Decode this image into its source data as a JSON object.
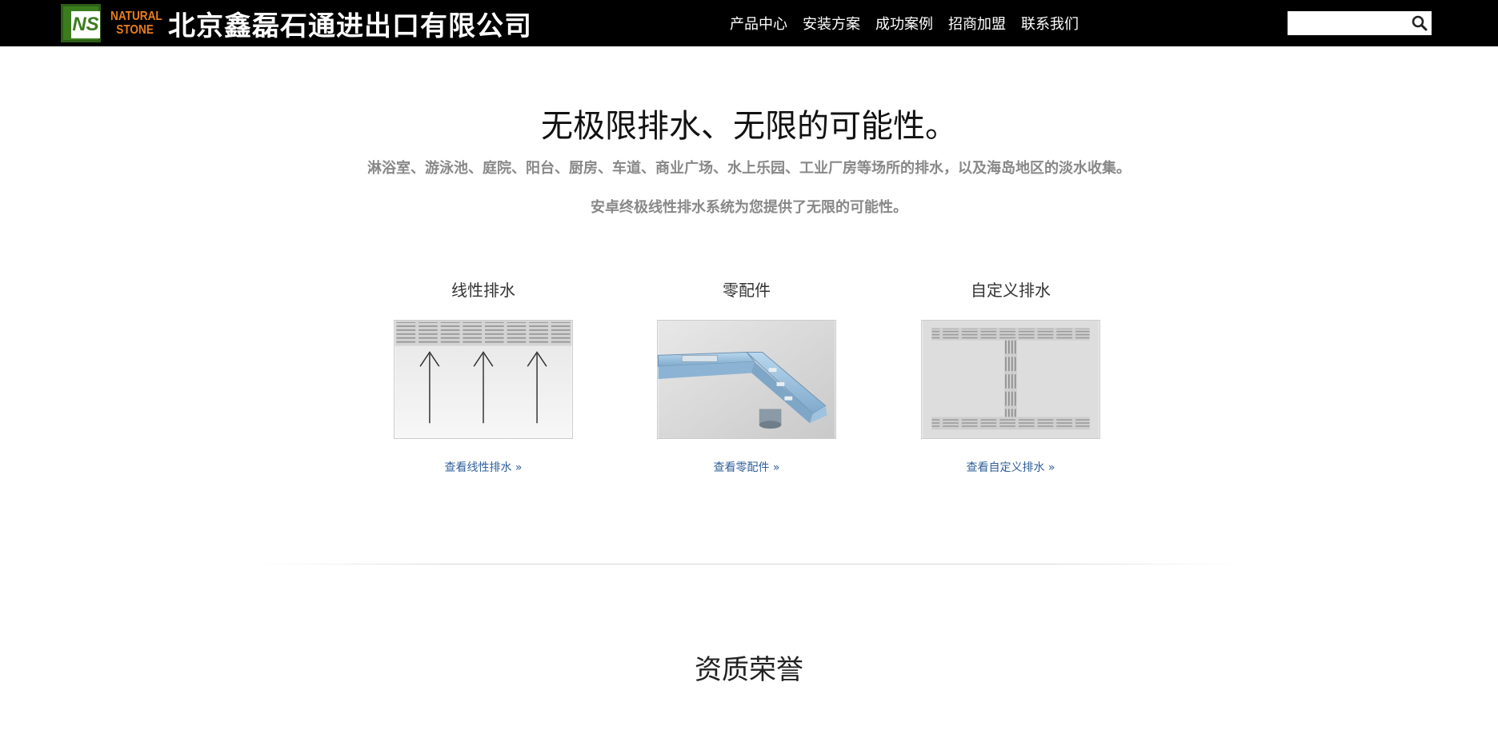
{
  "header": {
    "logo_mark": "NS",
    "logo_en_line1": "NATURAL",
    "logo_en_line2": "STONE",
    "company_name": "北京鑫磊石通进出口有限公司",
    "nav": [
      {
        "label": "产品中心"
      },
      {
        "label": "安装方案"
      },
      {
        "label": "成功案例"
      },
      {
        "label": "招商加盟"
      },
      {
        "label": "联系我们"
      }
    ],
    "search": {
      "value": "",
      "placeholder": "",
      "icon": "search-icon"
    }
  },
  "hero": {
    "title": "无极限排水、无限的可能性。",
    "subtitle1": "淋浴室、游泳池、庭院、阳台、厨房、车道、商业广场、水上乐园、工业厂房等场所的排水，以及海岛地区的淡水收集。",
    "subtitle2": "安卓终极线性排水系统为您提供了无限的可能性。"
  },
  "products": [
    {
      "title": "线性排水",
      "link": "查看线性排水 »"
    },
    {
      "title": "零配件",
      "link": "查看零配件 »"
    },
    {
      "title": "自定义排水",
      "link": "查看自定义排水 »"
    }
  ],
  "honors": {
    "title": "资质荣誉"
  },
  "colors": {
    "topbar": "#000000",
    "logo_green": "#3b7d1e",
    "logo_orange": "#e87e1c",
    "link": "#2f5f9a",
    "muted_text": "#888888"
  }
}
